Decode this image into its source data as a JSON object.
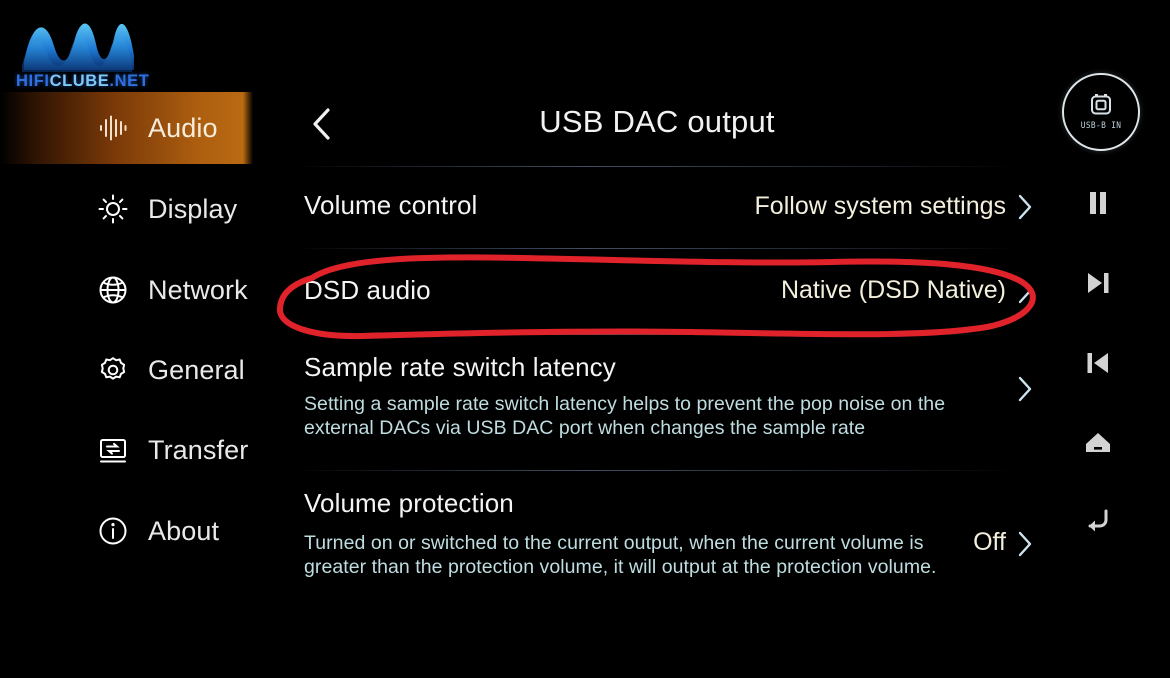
{
  "watermark": {
    "prefix": "HIFI",
    "mid": "CLUBE",
    "suffix": ".NET",
    "full": "HIFICLUBE.NET"
  },
  "sidebar": {
    "items": [
      {
        "label": "Audio",
        "icon": "audio-waveform-icon",
        "selected": true
      },
      {
        "label": "Display",
        "icon": "brightness-sun-icon",
        "selected": false
      },
      {
        "label": "Network",
        "icon": "globe-icon",
        "selected": false
      },
      {
        "label": "General",
        "icon": "gear-icon",
        "selected": false
      },
      {
        "label": "Transfer",
        "icon": "transfer-monitor-icon",
        "selected": false
      },
      {
        "label": "About",
        "icon": "info-circle-icon",
        "selected": false
      }
    ]
  },
  "header": {
    "title": "USB DAC output",
    "back_icon": "chevron-left-icon"
  },
  "rows": [
    {
      "title": "Volume control",
      "desc": "",
      "value": "Follow system settings",
      "chevron": "chevron-right-icon",
      "highlighted": false
    },
    {
      "title": "DSD audio",
      "desc": "",
      "value": "Native (DSD Native)",
      "chevron": "chevron-right-icon",
      "highlighted": true
    },
    {
      "title": "Sample rate switch latency",
      "desc": "Setting a sample rate switch latency helps to prevent the pop noise on the external DACs via USB DAC port when changes the sample rate",
      "value": "",
      "chevron": "chevron-right-icon",
      "highlighted": false
    },
    {
      "title": "Volume protection",
      "desc": "Turned on or switched to the current output, when the current volume is greater than the protection volume, it will output at the protection volume.",
      "value": "Off",
      "chevron": "chevron-right-icon",
      "highlighted": false
    }
  ],
  "rail": {
    "badge": {
      "label": "USB-B IN",
      "icon": "usb-b-port-icon"
    },
    "buttons": [
      {
        "icon": "pause-icon",
        "name": "pause-button"
      },
      {
        "icon": "next-track-icon",
        "name": "next-track-button"
      },
      {
        "icon": "prev-track-icon",
        "name": "previous-track-button"
      },
      {
        "icon": "home-icon",
        "name": "home-button"
      },
      {
        "icon": "back-arrow-icon",
        "name": "back-button"
      }
    ]
  },
  "annotation": {
    "shape": "red-ellipse-highlight",
    "color": "#e0222a",
    "target": "DSD audio"
  }
}
